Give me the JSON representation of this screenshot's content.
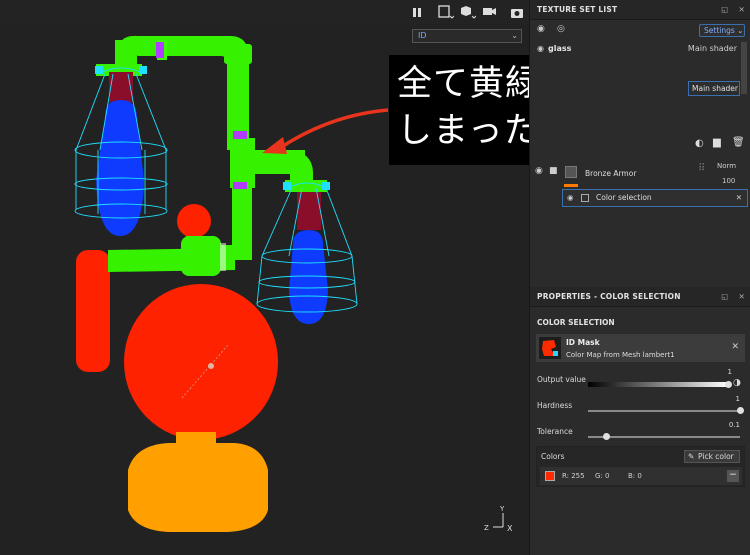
{
  "viewport": {
    "toolbar_icons": [
      "pause-icon",
      "frame-icon",
      "cube-icon",
      "camera-icon",
      "screenshot-icon"
    ],
    "channel_select": "ID",
    "axis_labels": {
      "y": "Y",
      "z": "Z",
      "x": "X"
    }
  },
  "callout": {
    "line1": "全て黄緑にして",
    "line2": "しまった。",
    "arrow_color": "#e8341c"
  },
  "texture_set_list": {
    "title": "TEXTURE SET LIST",
    "settings_label": "Settings",
    "rows": [
      {
        "name": "glass",
        "shader": "Main shader"
      }
    ],
    "shader_box": "Main shader"
  },
  "layers": {
    "layer_name": "Bronze Armor",
    "blend_mode": "Norm",
    "opacity": "100",
    "effect_name": "Color selection"
  },
  "properties": {
    "title": "PROPERTIES - COLOR SELECTION",
    "section": "COLOR SELECTION",
    "mask": {
      "name": "ID Mask",
      "source": "Color Map from Mesh lambert1"
    },
    "output_value": {
      "label": "Output value",
      "value": "1",
      "fraction": 1.0
    },
    "hardness": {
      "label": "Hardness",
      "value": "1",
      "fraction": 1.0
    },
    "tolerance": {
      "label": "Tolerance",
      "value": "0.1",
      "fraction": 0.1
    },
    "colors_label": "Colors",
    "pick_color": "Pick color",
    "color": {
      "r": "R: 255",
      "g": "G: 0",
      "b": "B: 0",
      "hex": "#ff2a00"
    }
  },
  "colors": {
    "accent": "#3a6fb0",
    "selected_green": "#36f200",
    "mesh_red": "#ff2200",
    "mesh_orange": "#ff9f00",
    "bulb_blue": "#0f3bff"
  }
}
